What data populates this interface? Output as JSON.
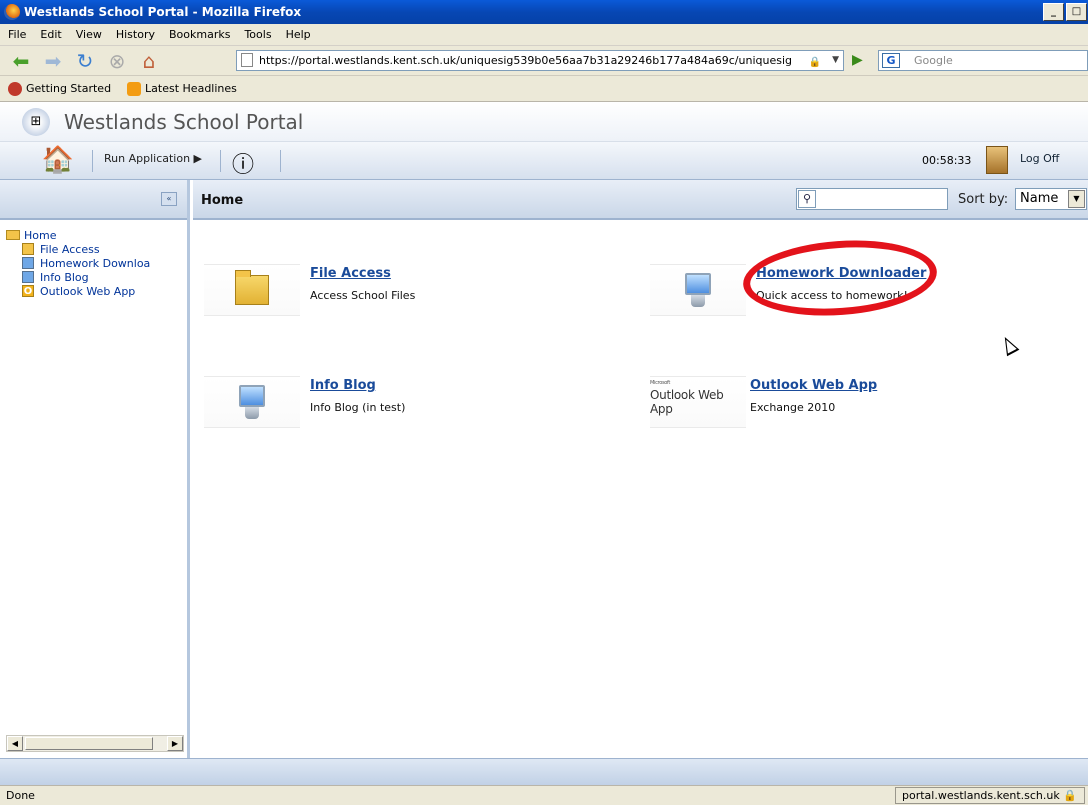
{
  "window": {
    "title": "Westlands School Portal - Mozilla Firefox",
    "controls": [
      "_",
      "□",
      "×"
    ]
  },
  "menu": [
    "File",
    "Edit",
    "View",
    "History",
    "Bookmarks",
    "Tools",
    "Help"
  ],
  "nav": {
    "url": "https://portal.westlands.kent.sch.uk/uniquesig539b0e56aa7b31a29246b177a484a69c/uniquesig",
    "search_placeholder": "Google",
    "search_engine_label": "G"
  },
  "bookmarks": [
    "Getting Started",
    "Latest Headlines"
  ],
  "portal": {
    "title": "Westlands School Portal",
    "toolbar": {
      "run_application": "Run Application",
      "timer": "00:58:33",
      "log_off": "Log Off"
    }
  },
  "tree": {
    "root": "Home",
    "items": [
      "File Access",
      "Homework Downloa",
      "Info Blog",
      "Outlook Web App"
    ]
  },
  "main": {
    "title": "Home",
    "sort_label": "Sort by:",
    "sort_value": "Name",
    "tiles": [
      {
        "name": "File Access",
        "desc": "Access School Files",
        "icon": "folder-icon"
      },
      {
        "name": "Homework Downloader",
        "desc": "Quick access to homework!",
        "icon": "monitor-icon"
      },
      {
        "name": "Info Blog",
        "desc": "Info Blog (in test)",
        "icon": "monitor-icon"
      },
      {
        "name": "Outlook Web App",
        "desc": "Exchange 2010",
        "icon": "outlook-logo",
        "logo_text": "Outlook Web App",
        "logo_small": "Microsoft"
      }
    ]
  },
  "status": {
    "left": "Done",
    "right": "portal.westlands.kent.sch.uk"
  },
  "colors": {
    "title_blue": "#0747b4",
    "link_blue": "#1a4b9a",
    "annotation_red": "#e3131b",
    "chrome": "#ece9d8"
  }
}
